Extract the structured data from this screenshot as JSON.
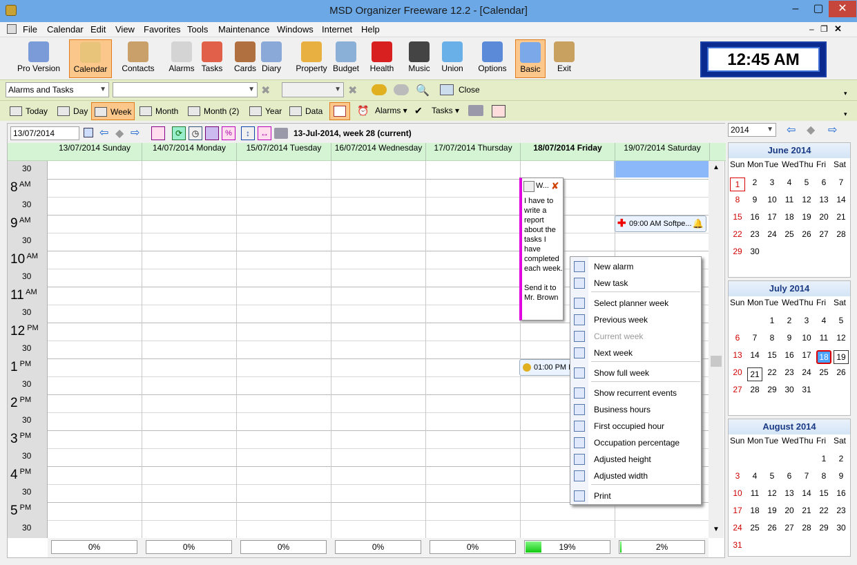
{
  "window": {
    "title": "MSD Organizer Freeware 12.2 - [Calendar]"
  },
  "menu": [
    "File",
    "Calendar",
    "Edit",
    "View",
    "Favorites",
    "Tools",
    "Maintenance",
    "Windows",
    "Internet",
    "Help"
  ],
  "toolbar": [
    {
      "label": "Pro Version",
      "icon": "pro-version-icon"
    },
    {
      "label": "Calendar",
      "icon": "calendar-icon",
      "selected": true
    },
    {
      "label": "Contacts",
      "icon": "contacts-icon"
    },
    {
      "label": "Alarms",
      "icon": "alarm-clock-icon"
    },
    {
      "label": "Tasks",
      "icon": "tasks-icon"
    },
    {
      "label": "Cards",
      "icon": "cards-icon"
    },
    {
      "label": "Diary",
      "icon": "diary-icon"
    },
    {
      "label": "Property",
      "icon": "house-icon"
    },
    {
      "label": "Budget",
      "icon": "calculator-icon"
    },
    {
      "label": "Health",
      "icon": "red-cross-icon"
    },
    {
      "label": "Music",
      "icon": "music-icon"
    },
    {
      "label": "Union",
      "icon": "puzzle-icon"
    },
    {
      "label": "Options",
      "icon": "gears-icon"
    },
    {
      "label": "Basic",
      "icon": "window-icon",
      "selected": true
    },
    {
      "label": "Exit",
      "icon": "exit-door-icon"
    }
  ],
  "clock": "12:45 AM",
  "filter": {
    "category": "Alarms and Tasks",
    "close_label": "Close"
  },
  "views": [
    {
      "label": "Today",
      "icon": "today-icon"
    },
    {
      "label": "Day",
      "icon": "day-view-icon"
    },
    {
      "label": "Week",
      "icon": "week-view-icon",
      "selected": true
    },
    {
      "label": "Month",
      "icon": "month-view-icon"
    },
    {
      "label": "Month (2)",
      "icon": "month-2-view-icon"
    },
    {
      "label": "Year",
      "icon": "year-view-icon"
    },
    {
      "label": "Data",
      "icon": "data-view-icon"
    }
  ],
  "views_extra": {
    "alarms": "Alarms",
    "tasks": "Tasks"
  },
  "nav": {
    "date": "13/07/2014",
    "week_label": "13-Jul-2014, week 28 (current)"
  },
  "days": [
    {
      "label": "13/07/2014 Sunday"
    },
    {
      "label": "14/07/2014 Monday"
    },
    {
      "label": "15/07/2014 Tuesday"
    },
    {
      "label": "16/07/2014 Wednesday"
    },
    {
      "label": "17/07/2014 Thursday"
    },
    {
      "label": "18/07/2014 Friday",
      "bold": true
    },
    {
      "label": "19/07/2014 Saturday"
    }
  ],
  "times": {
    "hours": [
      {
        "h": "8",
        "ap": "AM"
      },
      {
        "h": "9",
        "ap": "AM"
      },
      {
        "h": "10",
        "ap": "AM"
      },
      {
        "h": "11",
        "ap": "AM"
      },
      {
        "h": "12",
        "ap": "PM"
      },
      {
        "h": "1",
        "ap": "PM"
      },
      {
        "h": "2",
        "ap": "PM"
      },
      {
        "h": "3",
        "ap": "PM"
      },
      {
        "h": "4",
        "ap": "PM"
      },
      {
        "h": "5",
        "ap": "PM"
      }
    ],
    "half": "30"
  },
  "occupation": [
    "0%",
    "0%",
    "0%",
    "0%",
    "0%",
    "19%",
    "2%"
  ],
  "occupation_fill": [
    0,
    0,
    0,
    0,
    0,
    0.19,
    0.02
  ],
  "note": {
    "title": "W...",
    "text": "I have to write a report about the tasks I have completed each week.",
    "text2": "Send it to Mr. Brown"
  },
  "events": {
    "sat_9am": "09:00 AM Softpe...",
    "fri_1pm": "01:00 PM B"
  },
  "context_menu": [
    {
      "label": "New alarm",
      "icon": "new-alarm-icon"
    },
    {
      "label": "New task",
      "icon": "new-task-icon"
    },
    {
      "label": "Select planner week",
      "icon": "planner-week-icon"
    },
    {
      "label": "Previous week",
      "icon": "arrow-left-icon"
    },
    {
      "label": "Current week",
      "icon": "diamond-icon",
      "disabled": true
    },
    {
      "label": "Next week",
      "icon": "arrow-right-icon"
    },
    {
      "label": "Show full week",
      "icon": "full-week-icon"
    },
    {
      "label": "Show recurrent events",
      "icon": "recurrent-icon"
    },
    {
      "label": "Business hours",
      "icon": "clock-icon"
    },
    {
      "label": "First occupied hour",
      "icon": "first-hour-icon"
    },
    {
      "label": "Occupation percentage",
      "icon": "percentage-icon"
    },
    {
      "label": "Adjusted height",
      "icon": "adjust-height-icon"
    },
    {
      "label": "Adjusted width",
      "icon": "adjust-width-icon"
    },
    {
      "label": "Print",
      "icon": "printer-icon"
    }
  ],
  "year_combo": "2014",
  "weekdays": [
    "Sun",
    "Mon",
    "Tue",
    "Wed",
    "Thu",
    "Fri",
    "Sat"
  ],
  "months": [
    {
      "name": "June 2014",
      "start": 0,
      "days": 30,
      "boxed": [
        1
      ]
    },
    {
      "name": "July 2014",
      "start": 2,
      "days": 31,
      "selected": 18,
      "boxed": [
        19
      ],
      "boxed2": [
        21
      ]
    },
    {
      "name": "August 2014",
      "start": 5,
      "days": 31
    }
  ]
}
